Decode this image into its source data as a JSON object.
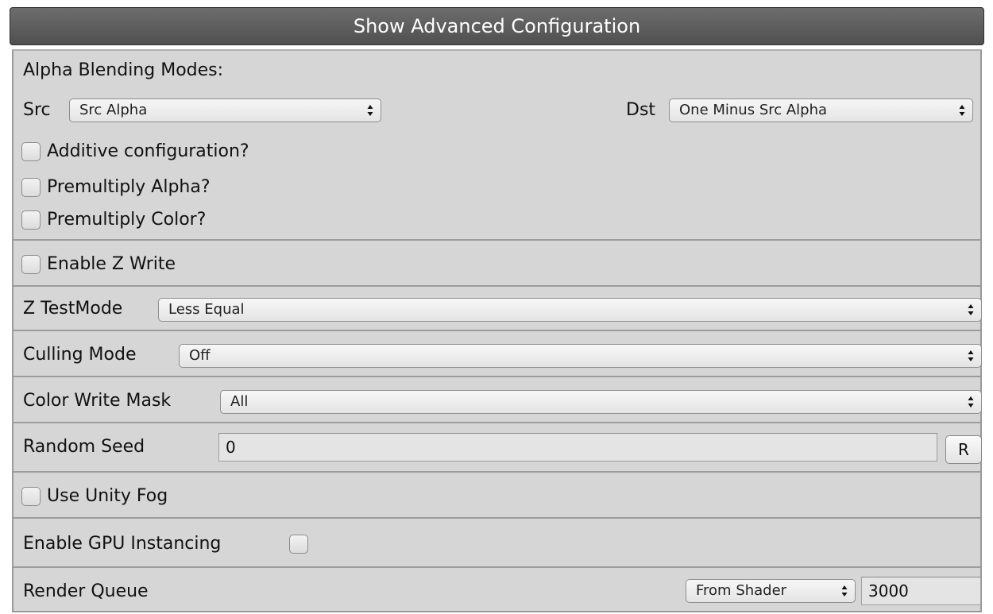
{
  "header": {
    "title": "Show Advanced Configuration"
  },
  "alpha_blending": {
    "title": "Alpha Blending Modes:",
    "src_label": "Src",
    "src_value": "Src Alpha",
    "dst_label": "Dst",
    "dst_value": "One Minus Src Alpha",
    "additive_label": "Additive configuration?",
    "premultiply_alpha_label": "Premultiply Alpha?",
    "premultiply_color_label": "Premultiply Color?",
    "additive_checked": false,
    "premultiply_alpha_checked": false,
    "premultiply_color_checked": false
  },
  "z_write": {
    "label": "Enable Z Write",
    "checked": false
  },
  "z_test": {
    "label": "Z TestMode",
    "value": "Less Equal"
  },
  "culling": {
    "label": "Culling Mode",
    "value": "Off"
  },
  "color_mask": {
    "label": "Color Write Mask",
    "value": "All"
  },
  "random_seed": {
    "label": "Random Seed",
    "value": "0",
    "button_label": "R"
  },
  "fog": {
    "label": "Use Unity Fog",
    "checked": false
  },
  "gpu_instancing": {
    "label": "Enable GPU Instancing",
    "checked": false
  },
  "render_queue": {
    "label": "Render Queue",
    "mode": "From Shader",
    "value": "3000"
  },
  "icons": {
    "select_arrows": "updown-arrows-icon"
  }
}
